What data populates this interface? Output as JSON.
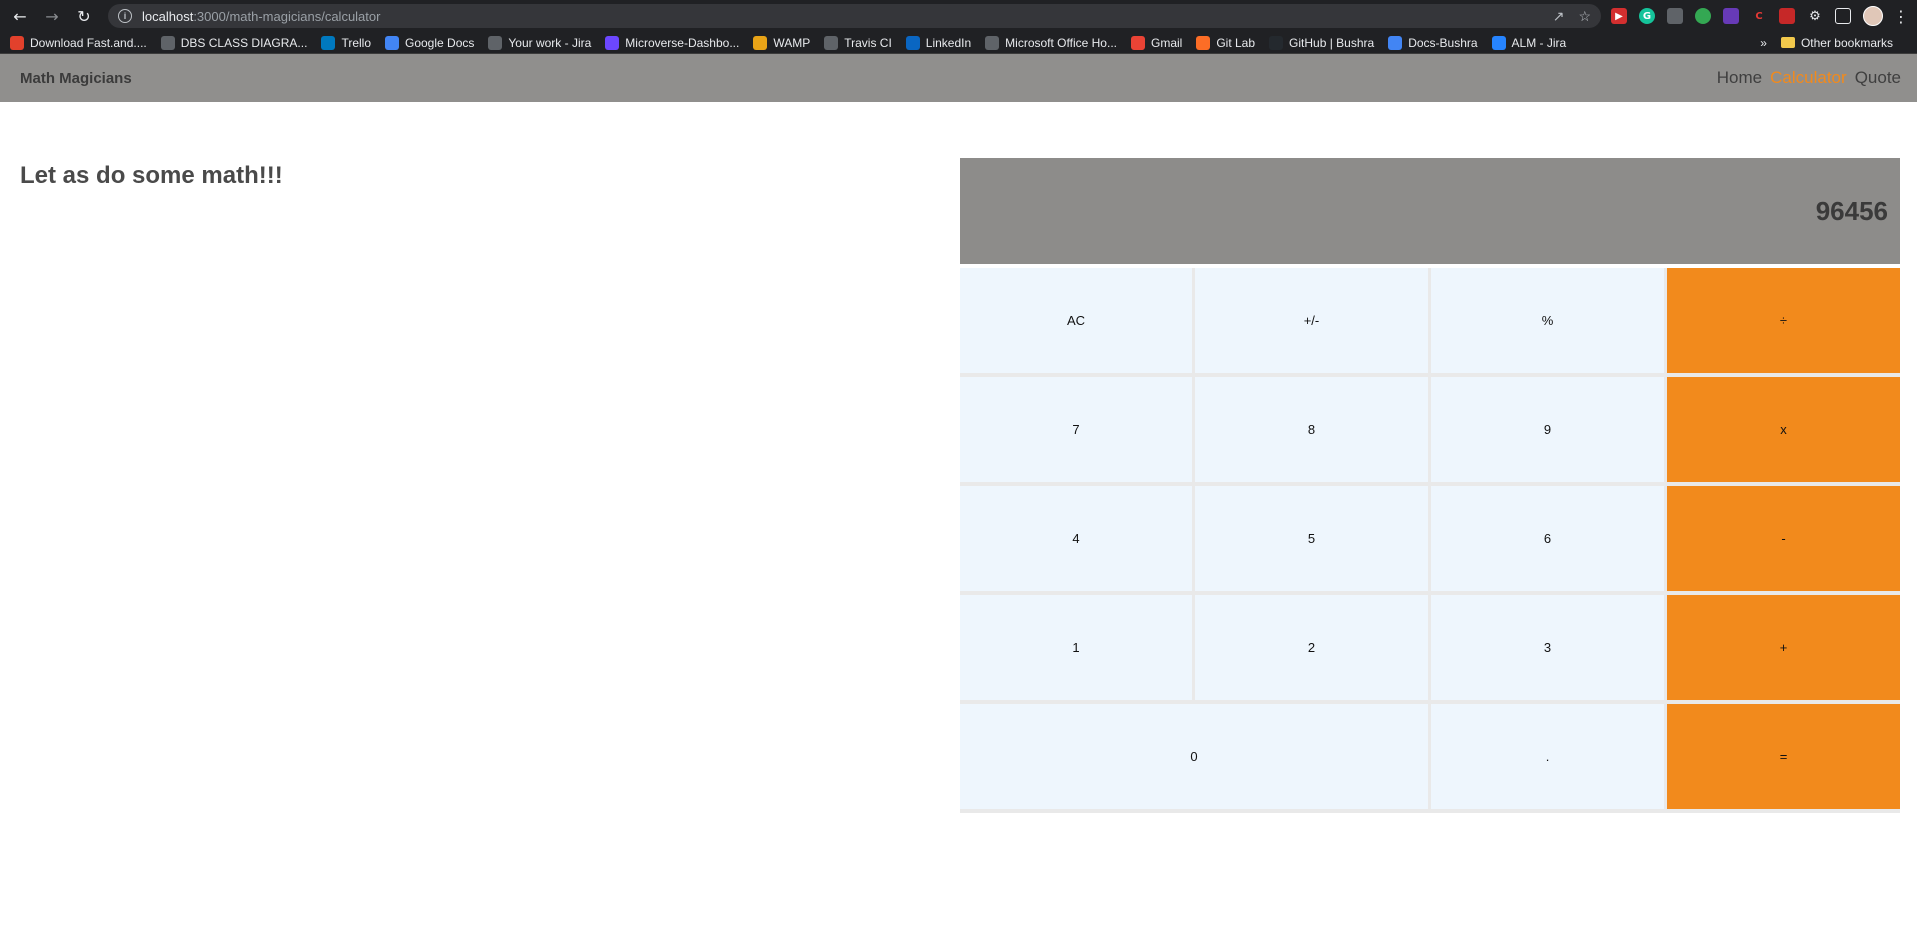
{
  "browser": {
    "url_host": "localhost",
    "url_path": ":3000/math-magicians/calculator",
    "bookmarks": [
      {
        "label": "Download Fast.and....",
        "icon": "x-icon",
        "color": "#e2412c"
      },
      {
        "label": "DBS CLASS DIAGRA...",
        "icon": "globe-icon",
        "color": "#5f6368"
      },
      {
        "label": "Trello",
        "icon": "trello-icon",
        "color": "#0079bf"
      },
      {
        "label": "Google Docs",
        "icon": "docs-icon",
        "color": "#4285f4"
      },
      {
        "label": "Your work - Jira",
        "icon": "globe-icon",
        "color": "#5f6368"
      },
      {
        "label": "Microverse-Dashbo...",
        "icon": "microverse-icon",
        "color": "#6c47ff"
      },
      {
        "label": "WAMP",
        "icon": "wamp-icon",
        "color": "#e8a317"
      },
      {
        "label": "Travis CI",
        "icon": "globe-icon",
        "color": "#5f6368"
      },
      {
        "label": "LinkedIn",
        "icon": "linkedin-icon",
        "color": "#0a66c2"
      },
      {
        "label": "Microsoft Office Ho...",
        "icon": "globe-icon",
        "color": "#5f6368"
      },
      {
        "label": "Gmail",
        "icon": "gmail-icon",
        "color": "#ea4335"
      },
      {
        "label": "Git Lab",
        "icon": "gitlab-icon",
        "color": "#fc6d26"
      },
      {
        "label": "GitHub | Bushra",
        "icon": "github-icon",
        "color": "#24292e"
      },
      {
        "label": "Docs-Bushra",
        "icon": "docs-icon",
        "color": "#4285f4"
      },
      {
        "label": "ALM - Jira",
        "icon": "jira-icon",
        "color": "#2684ff"
      }
    ],
    "more_bookmarks": "»",
    "other_bookmarks": "Other bookmarks"
  },
  "app": {
    "brand": "Math Magicians",
    "nav": [
      "Home",
      "Calculator",
      "Quote"
    ],
    "active_nav": "Calculator",
    "headline": "Let as do some math!!!",
    "display_value": "96456",
    "keys": [
      {
        "label": "AC",
        "type": "num"
      },
      {
        "label": "+/-",
        "type": "num"
      },
      {
        "label": "%",
        "type": "num"
      },
      {
        "label": "÷",
        "type": "op"
      },
      {
        "label": "7",
        "type": "num"
      },
      {
        "label": "8",
        "type": "num"
      },
      {
        "label": "9",
        "type": "num"
      },
      {
        "label": "x",
        "type": "op"
      },
      {
        "label": "4",
        "type": "num"
      },
      {
        "label": "5",
        "type": "num"
      },
      {
        "label": "6",
        "type": "num"
      },
      {
        "label": "-",
        "type": "op"
      },
      {
        "label": "1",
        "type": "num"
      },
      {
        "label": "2",
        "type": "num"
      },
      {
        "label": "3",
        "type": "num"
      },
      {
        "label": "+",
        "type": "op"
      },
      {
        "label": "0",
        "type": "zero"
      },
      {
        "label": ".",
        "type": "num"
      },
      {
        "label": "=",
        "type": "op"
      }
    ],
    "colors": {
      "accent": "#f28a1c",
      "nav_bg": "#908f8d",
      "display_bg": "#8d8c8a",
      "key_bg": "#eef6fd"
    }
  }
}
